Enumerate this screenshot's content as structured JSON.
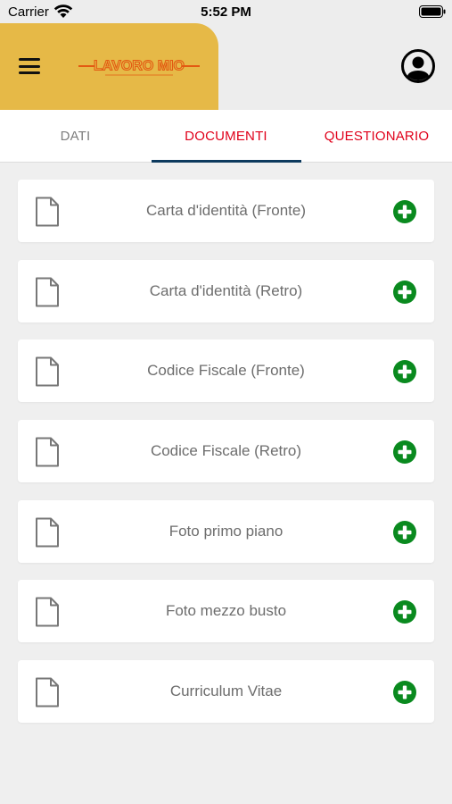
{
  "status_bar": {
    "carrier": "Carrier",
    "time": "5:52 PM",
    "icons": [
      "wifi-icon",
      "battery-icon"
    ]
  },
  "header": {
    "logo_text": "LAVORO MIO",
    "menu_icon": "menu-icon",
    "profile_icon": "profile-icon",
    "brand_color": "#e6b947",
    "logo_color": "#e35a12"
  },
  "tabs": [
    {
      "label": "DATI",
      "active": false
    },
    {
      "label": "DOCUMENTI",
      "active": true
    },
    {
      "label": "QUESTIONARIO",
      "active": false
    }
  ],
  "documents": [
    {
      "label": "Carta d'identità (Fronte)"
    },
    {
      "label": "Carta d'identità (Retro)"
    },
    {
      "label": "Codice Fiscale (Fronte)"
    },
    {
      "label": "Codice Fiscale (Retro)"
    },
    {
      "label": "Foto primo piano"
    },
    {
      "label": "Foto mezzo busto"
    },
    {
      "label": "Curriculum Vitae"
    }
  ],
  "colors": {
    "accent_red": "#e0001a",
    "add_green": "#0a8a1f",
    "tab_indicator": "#0d3a5e"
  }
}
